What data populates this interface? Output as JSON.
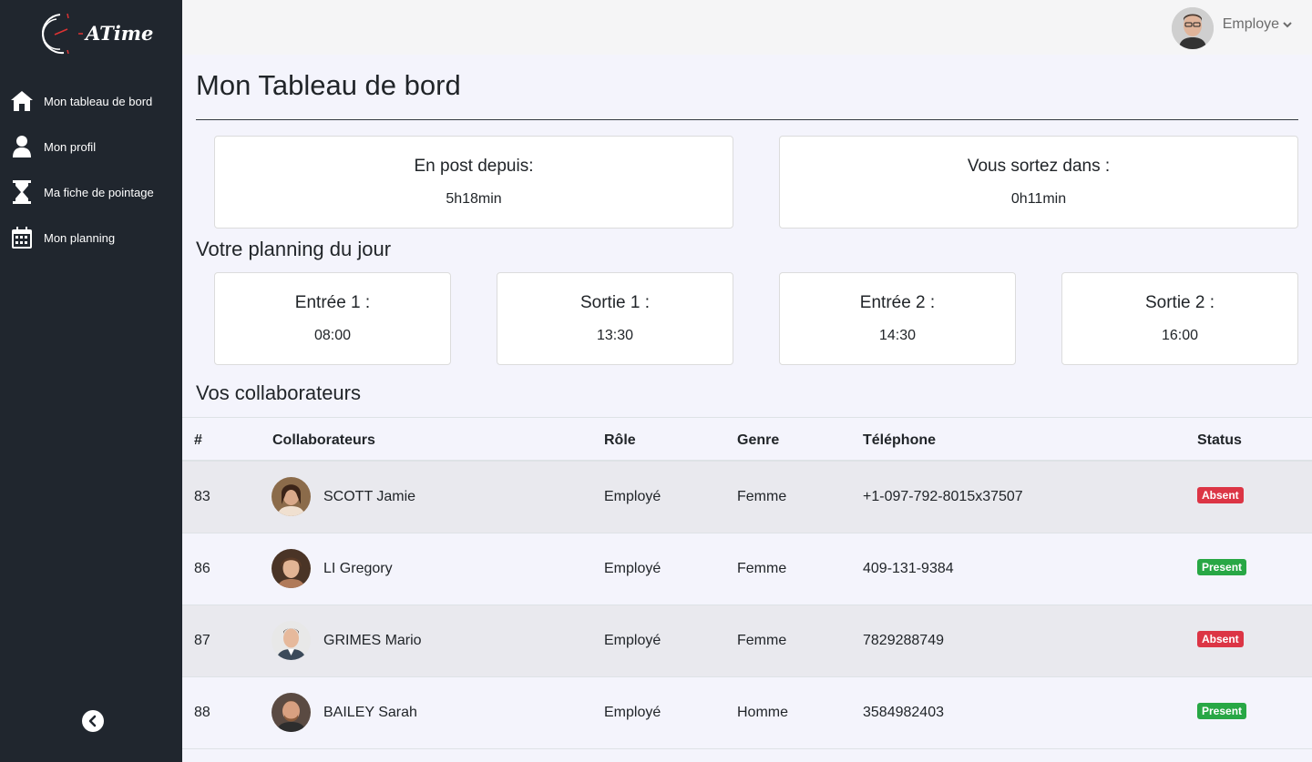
{
  "app": {
    "logo_text": "ATime"
  },
  "sidebar": {
    "items": [
      {
        "label": "Mon tableau de bord",
        "icon": "home-icon"
      },
      {
        "label": "Mon profil",
        "icon": "user-icon"
      },
      {
        "label": "Ma fiche de pointage",
        "icon": "hourglass-icon"
      },
      {
        "label": "Mon planning",
        "icon": "calendar-icon"
      }
    ],
    "collapse_icon": "chevron-left-icon"
  },
  "header": {
    "user_label": "Employe"
  },
  "main": {
    "title": "Mon Tableau de bord",
    "stats": [
      {
        "title": "En post depuis:",
        "value": "5h18min"
      },
      {
        "title": "Vous sortez dans :",
        "value": "0h11min"
      }
    ],
    "planning_title": "Votre planning du jour",
    "planning": [
      {
        "title": "Entrée 1 :",
        "value": "08:00"
      },
      {
        "title": "Sortie 1 :",
        "value": "13:30"
      },
      {
        "title": "Entrée 2 :",
        "value": "14:30"
      },
      {
        "title": "Sortie 2 :",
        "value": "16:00"
      }
    ],
    "collab_title": "Vos collaborateurs"
  },
  "table": {
    "headers": [
      "#",
      "Collaborateurs",
      "Rôle",
      "Genre",
      "Téléphone",
      "Status"
    ],
    "rows": [
      {
        "id": "83",
        "name": "SCOTT Jamie",
        "role": "Employé",
        "genre": "Femme",
        "phone": "+1-097-792-8015x37507",
        "status": "Absent"
      },
      {
        "id": "86",
        "name": "LI Gregory",
        "role": "Employé",
        "genre": "Femme",
        "phone": "409-131-9384",
        "status": "Present"
      },
      {
        "id": "87",
        "name": "GRIMES Mario",
        "role": "Employé",
        "genre": "Femme",
        "phone": "7829288749",
        "status": "Absent"
      },
      {
        "id": "88",
        "name": "BAILEY Sarah",
        "role": "Employé",
        "genre": "Homme",
        "phone": "3584982403",
        "status": "Present"
      }
    ]
  },
  "colors": {
    "sidebar_bg": "#20262e",
    "absent": "#dc3545",
    "present": "#28a745"
  }
}
